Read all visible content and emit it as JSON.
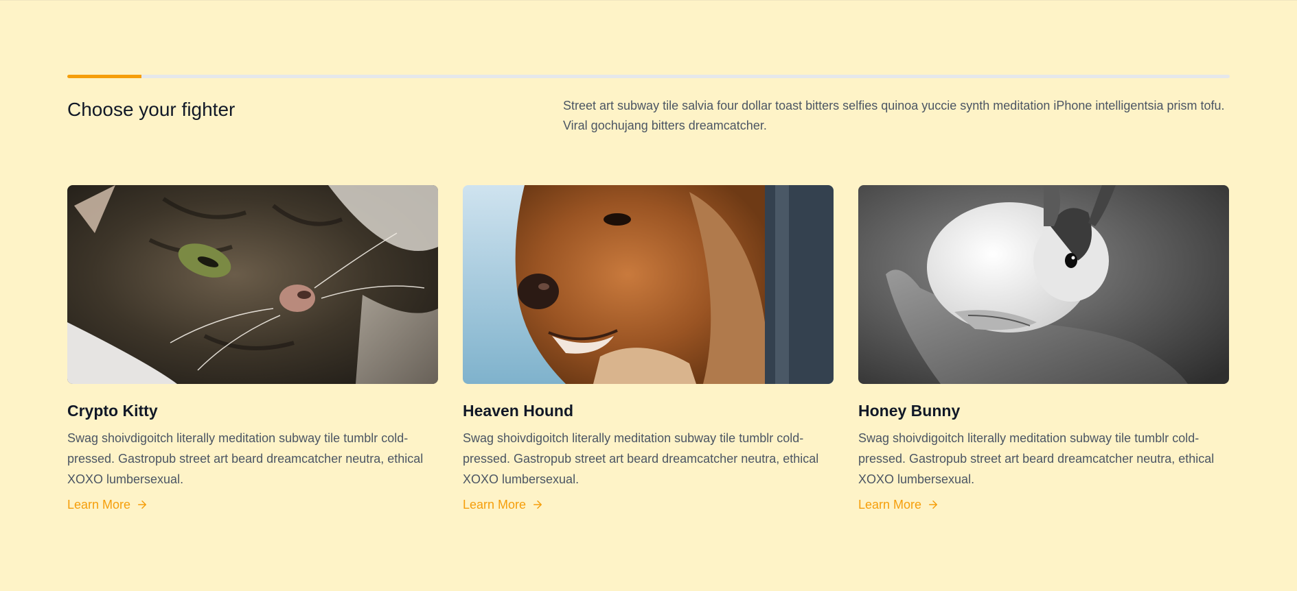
{
  "progress": {
    "fraction": 0.064,
    "accent": "#f59e0b",
    "track": "#e5e7eb"
  },
  "header": {
    "title": "Choose your fighter",
    "description": "Street art subway tile salvia four dollar toast bitters selfies quinoa yuccie synth meditation iPhone intelligentsia prism tofu. Viral gochujang bitters dreamcatcher."
  },
  "cards": [
    {
      "title": "Crypto Kitty",
      "body": "Swag shoivdigoitch literally meditation subway tile tumblr cold-pressed. Gastropub street art beard dreamcatcher neutra, ethical XOXO lumbersexual.",
      "link": "Learn More",
      "image_icon": "cat-photo"
    },
    {
      "title": "Heaven Hound",
      "body": "Swag shoivdigoitch literally meditation subway tile tumblr cold-pressed. Gastropub street art beard dreamcatcher neutra, ethical XOXO lumbersexual.",
      "link": "Learn More",
      "image_icon": "dog-photo"
    },
    {
      "title": "Honey Bunny",
      "body": "Swag shoivdigoitch literally meditation subway tile tumblr cold-pressed. Gastropub street art beard dreamcatcher neutra, ethical XOXO lumbersexual.",
      "link": "Learn More",
      "image_icon": "rabbit-photo"
    }
  ],
  "colors": {
    "background": "#fef3c7",
    "accent": "#f59e0b",
    "text": "#111827",
    "muted": "#4b5563"
  }
}
